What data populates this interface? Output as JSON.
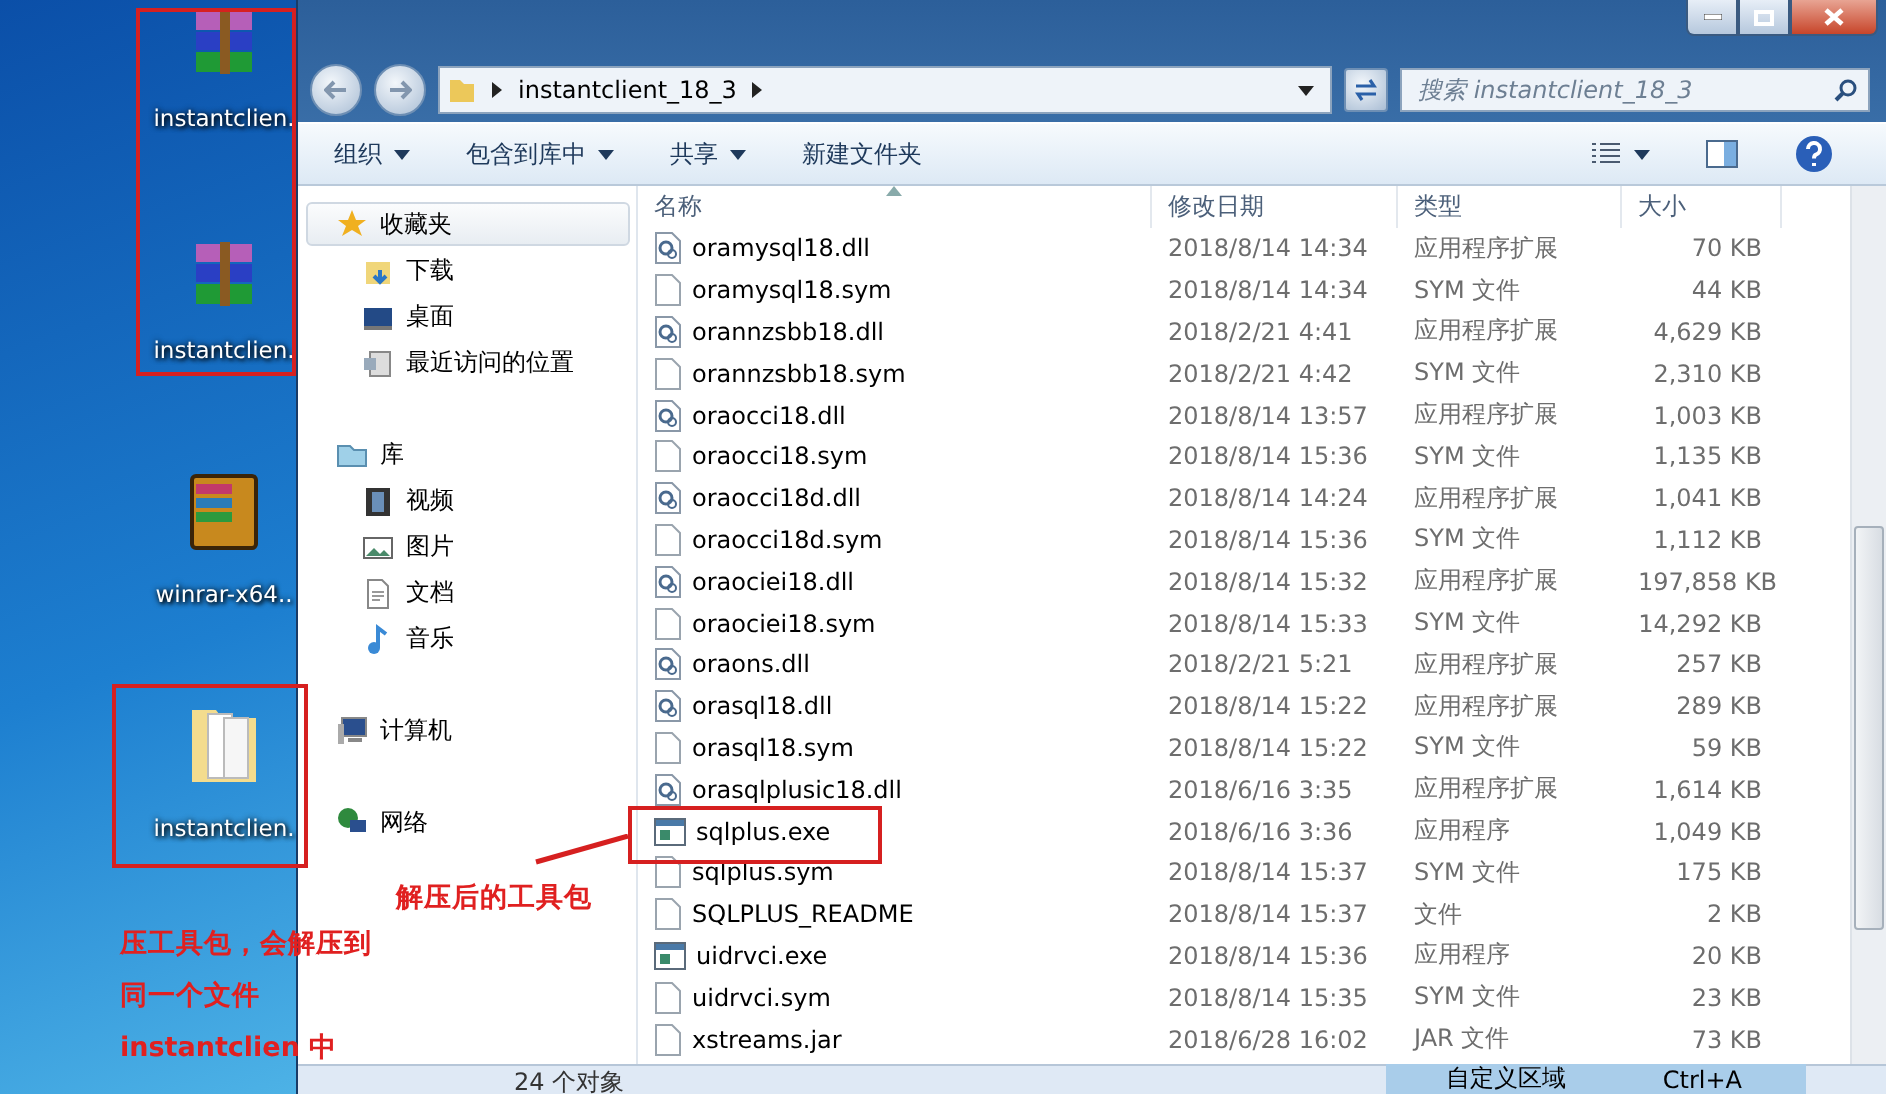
{
  "desktop_icons": [
    {
      "kind": "archive",
      "label": "instantclien."
    },
    {
      "kind": "archive",
      "label": "instantclien."
    },
    {
      "kind": "installer",
      "label": "winrar-x64.."
    },
    {
      "kind": "folder",
      "label": "instantclien."
    }
  ],
  "window": {
    "breadcrumb": "instantclient_18_3",
    "search": {
      "placeholder": "搜索 instantclient_18_3"
    }
  },
  "toolbar": [
    {
      "label": "组织",
      "dropdown": true
    },
    {
      "label": "包含到库中",
      "dropdown": true
    },
    {
      "label": "共享",
      "dropdown": true
    },
    {
      "label": "新建文件夹",
      "dropdown": false
    }
  ],
  "sidebar": [
    {
      "kind": "favorites",
      "label": "收藏夹",
      "highlighted": true,
      "children": [
        {
          "kind": "download",
          "label": "下载"
        },
        {
          "kind": "desktop",
          "label": "桌面"
        },
        {
          "kind": "recent",
          "label": "最近访问的位置"
        }
      ]
    },
    {
      "kind": "library",
      "label": "库",
      "highlighted": false,
      "children": [
        {
          "kind": "video",
          "label": "视频"
        },
        {
          "kind": "image",
          "label": "图片"
        },
        {
          "kind": "document",
          "label": "文档"
        },
        {
          "kind": "music",
          "label": "音乐"
        }
      ]
    },
    {
      "kind": "computer",
      "label": "计算机",
      "highlighted": false
    },
    {
      "kind": "network",
      "label": "网络",
      "highlighted": false
    }
  ],
  "table": {
    "columns": [
      "名称",
      "修改日期",
      "类型",
      "大小"
    ],
    "rows": [
      {
        "kind": "dll",
        "name": "oramysql18.dll",
        "date": "2018/8/14 14:34",
        "type": "应用程序扩展",
        "size": "70 KB"
      },
      {
        "kind": "file",
        "name": "oramysql18.sym",
        "date": "2018/8/14 14:34",
        "type": "SYM 文件",
        "size": "44 KB"
      },
      {
        "kind": "dll",
        "name": "orannzsbb18.dll",
        "date": "2018/2/21 4:41",
        "type": "应用程序扩展",
        "size": "4,629 KB"
      },
      {
        "kind": "file",
        "name": "orannzsbb18.sym",
        "date": "2018/2/21 4:42",
        "type": "SYM 文件",
        "size": "2,310 KB"
      },
      {
        "kind": "dll",
        "name": "oraocci18.dll",
        "date": "2018/8/14 13:57",
        "type": "应用程序扩展",
        "size": "1,003 KB"
      },
      {
        "kind": "file",
        "name": "oraocci18.sym",
        "date": "2018/8/14 15:36",
        "type": "SYM 文件",
        "size": "1,135 KB"
      },
      {
        "kind": "dll",
        "name": "oraocci18d.dll",
        "date": "2018/8/14 14:24",
        "type": "应用程序扩展",
        "size": "1,041 KB"
      },
      {
        "kind": "file",
        "name": "oraocci18d.sym",
        "date": "2018/8/14 15:36",
        "type": "SYM 文件",
        "size": "1,112 KB"
      },
      {
        "kind": "dll",
        "name": "oraociei18.dll",
        "date": "2018/8/14 15:32",
        "type": "应用程序扩展",
        "size": "197,858 KB"
      },
      {
        "kind": "file",
        "name": "oraociei18.sym",
        "date": "2018/8/14 15:33",
        "type": "SYM 文件",
        "size": "14,292 KB"
      },
      {
        "kind": "dll",
        "name": "oraons.dll",
        "date": "2018/2/21 5:21",
        "type": "应用程序扩展",
        "size": "257 KB"
      },
      {
        "kind": "dll",
        "name": "orasql18.dll",
        "date": "2018/8/14 15:22",
        "type": "应用程序扩展",
        "size": "289 KB"
      },
      {
        "kind": "file",
        "name": "orasql18.sym",
        "date": "2018/8/14 15:22",
        "type": "SYM 文件",
        "size": "59 KB"
      },
      {
        "kind": "dll",
        "name": "orasqlplusic18.dll",
        "date": "2018/6/16 3:35",
        "type": "应用程序扩展",
        "size": "1,614 KB"
      },
      {
        "kind": "exe",
        "name": "sqlplus.exe",
        "date": "2018/6/16 3:36",
        "type": "应用程序",
        "size": "1,049 KB"
      },
      {
        "kind": "file",
        "name": "sqlplus.sym",
        "date": "2018/8/14 15:37",
        "type": "SYM 文件",
        "size": "175 KB"
      },
      {
        "kind": "file",
        "name": "SQLPLUS_README",
        "date": "2018/8/14 15:37",
        "type": "文件",
        "size": "2 KB"
      },
      {
        "kind": "exe",
        "name": "uidrvci.exe",
        "date": "2018/8/14 15:36",
        "type": "应用程序",
        "size": "20 KB"
      },
      {
        "kind": "file",
        "name": "uidrvci.sym",
        "date": "2018/8/14 15:35",
        "type": "SYM 文件",
        "size": "23 KB"
      },
      {
        "kind": "file",
        "name": "xstreams.jar",
        "date": "2018/6/28 16:02",
        "type": "JAR 文件",
        "size": "73 KB"
      }
    ]
  },
  "status_bar": "24 个对象",
  "tooltip": {
    "label": "自定义区域",
    "shortcut": "Ctrl+A"
  },
  "annotations": {
    "extract_note": "解压后的工具包",
    "archive_note": [
      "压工具包，会解压到",
      "同一个文件",
      "instantclien 中"
    ]
  }
}
